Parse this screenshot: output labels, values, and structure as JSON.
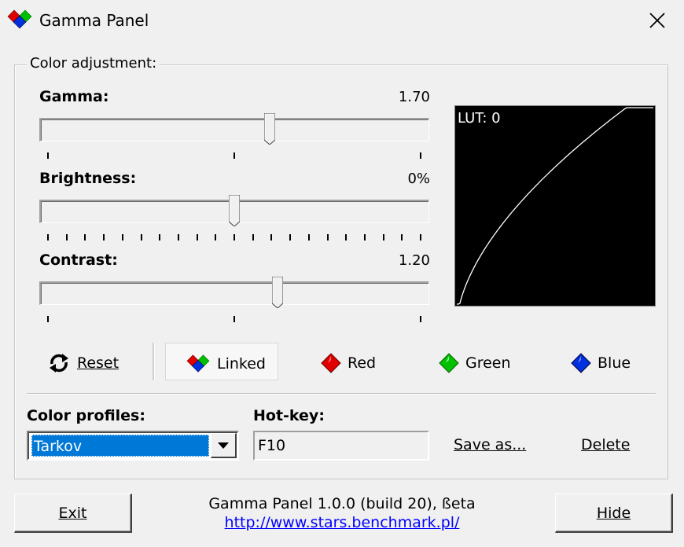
{
  "window": {
    "title": "Gamma Panel"
  },
  "group": {
    "legend": "Color adjustment:"
  },
  "sliders": {
    "gamma": {
      "label": "Gamma:",
      "value_text": "1.70",
      "position": 0.595
    },
    "brightness": {
      "label": "Brightness:",
      "value_text": "0%",
      "position": 0.5
    },
    "contrast": {
      "label": "Contrast:",
      "value_text": "1.20",
      "position": 0.615
    }
  },
  "lut": {
    "label": "LUT: 0"
  },
  "channels": {
    "reset": {
      "label": "Reset"
    },
    "linked": {
      "label": "Linked",
      "selected": true
    },
    "red": {
      "label": "Red",
      "color": "#e00000"
    },
    "green": {
      "label": "Green",
      "color": "#00c000"
    },
    "blue": {
      "label": "Blue",
      "color": "#0030e0"
    }
  },
  "profiles": {
    "label": "Color profiles:",
    "selected": "Tarkov"
  },
  "hotkey": {
    "label": "Hot-key:",
    "value": "F10"
  },
  "actions": {
    "save_as": "Save as...",
    "delete": "Delete"
  },
  "footer": {
    "exit": "Exit",
    "hide": "Hide",
    "version": "Gamma Panel 1.0.0 (build 20), ßeta",
    "url": "http://www.stars.benchmark.pl/"
  },
  "colors": {
    "accent": "#0078d7",
    "link": "#0000ff"
  }
}
